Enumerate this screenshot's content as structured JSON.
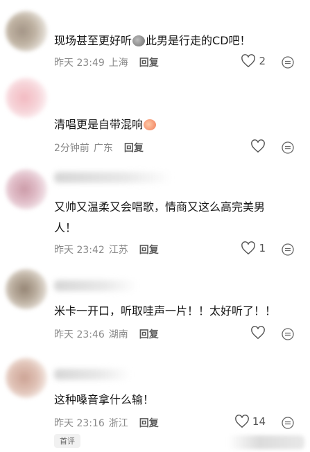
{
  "comments": [
    {
      "text_before": "现场甚至更好听",
      "emoji1": "poop-emoji",
      "text_after": "此男是行走的CD吧！",
      "time": "昨天 23:49",
      "location": "上海",
      "reply": "回复",
      "likes": "2"
    },
    {
      "text_before": "清唱更是自带混响",
      "emoji1": "peach-emoji",
      "text_after": "",
      "time": "2分钟前",
      "location": "广东",
      "reply": "回复",
      "likes": ""
    },
    {
      "text_line1": "又帅又温柔又会唱歌，情商又这么高完美男",
      "text_line2": "人！",
      "time": "昨天 23:42",
      "location": "江苏",
      "reply": "回复",
      "likes": "1"
    },
    {
      "text": "米卡一开口，听取哇声一片！！太好听了！！",
      "time": "昨天 23:46",
      "location": "湖南",
      "reply": "回复",
      "likes": ""
    },
    {
      "text": "这种嗓音拿什么输！",
      "time": "昨天 23:16",
      "location": "浙江",
      "reply": "回复",
      "likes": "14"
    }
  ],
  "footer_tag": "首评",
  "icons": {
    "like": "heart-outline-icon",
    "more": "more-circle-icon"
  }
}
